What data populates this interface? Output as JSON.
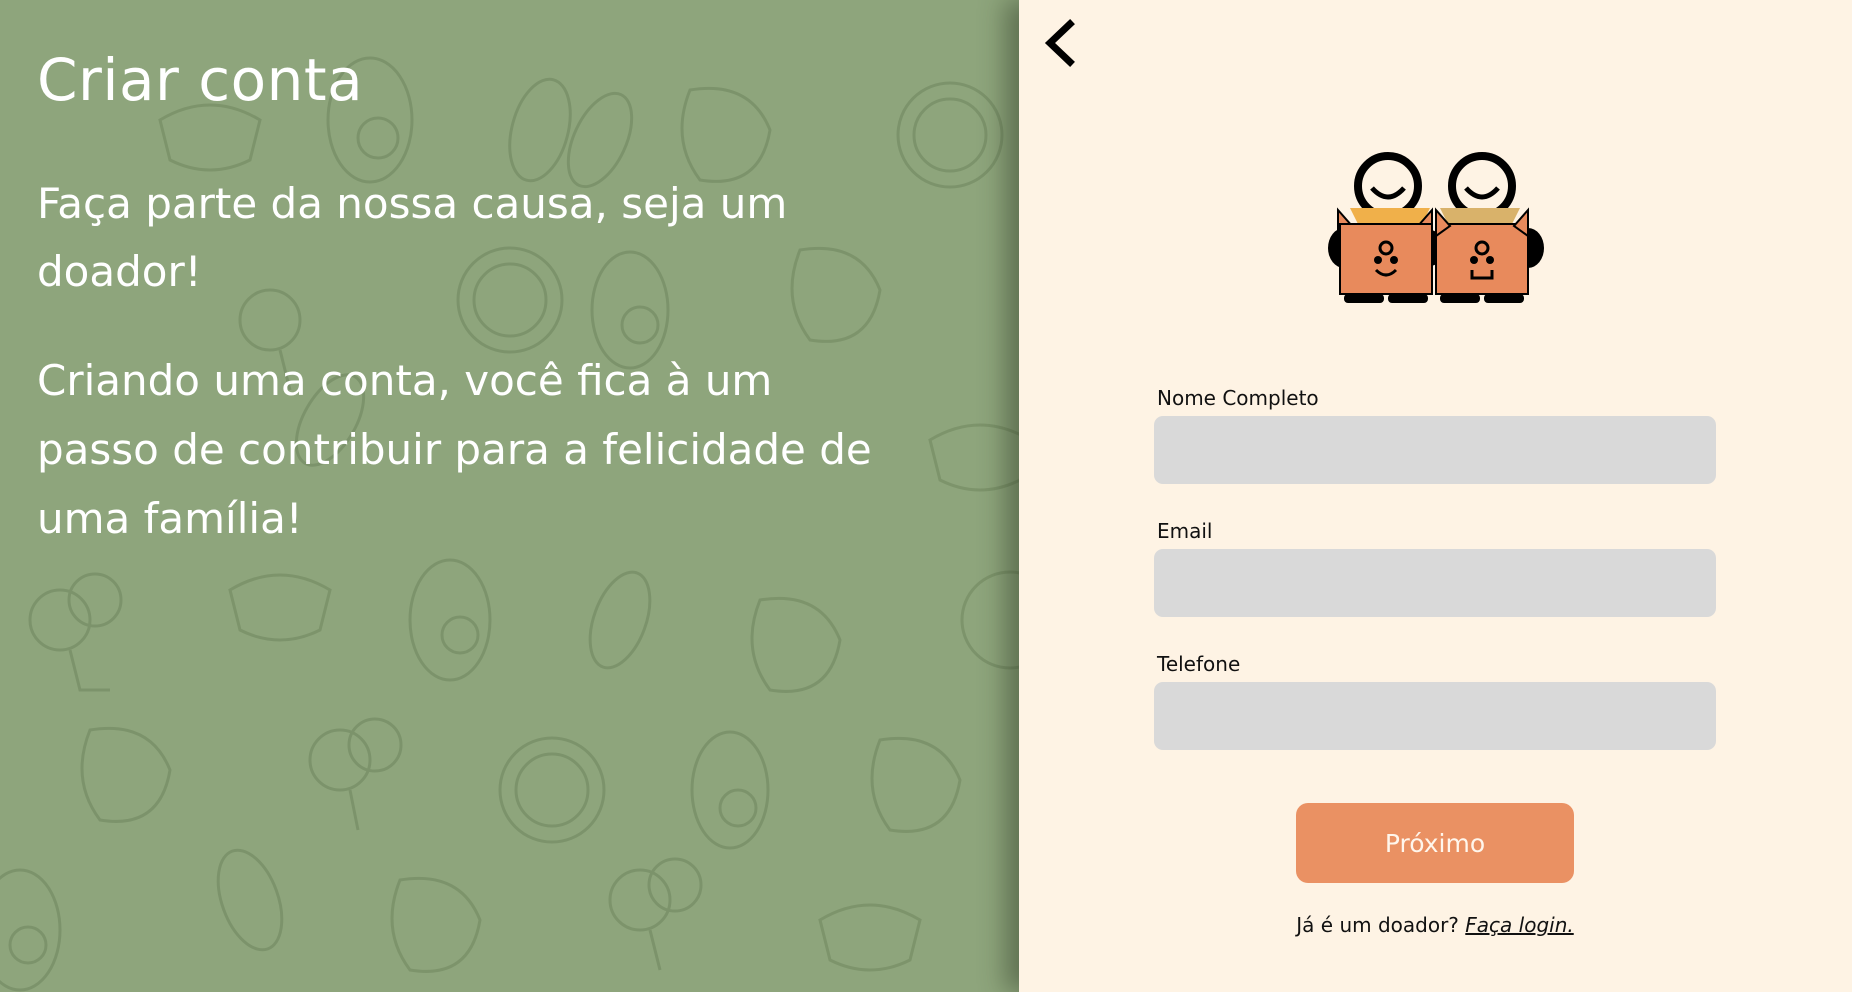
{
  "left": {
    "title": "Criar conta",
    "intro": "Faça parte da nossa causa, seja um doador!",
    "description": "Criando uma conta, você fica à um passo de contribuir para a felicidade de uma família!"
  },
  "header": {
    "back_icon": "chevron-left-icon"
  },
  "logo": {
    "icon": "donation-boxes-logo",
    "box_color": "#e88a5c"
  },
  "form": {
    "fields": [
      {
        "label": "Nome Completo",
        "value": "",
        "placeholder": ""
      },
      {
        "label": "Email",
        "value": "",
        "placeholder": ""
      },
      {
        "label": "Telefone",
        "value": "",
        "placeholder": ""
      }
    ],
    "next_label": "Próximo"
  },
  "footer": {
    "question": "Já é um doador?",
    "login_link": "Faça login."
  },
  "colors": {
    "left_bg": "#8ea57c",
    "right_bg": "#fef3e4",
    "input_bg": "#d9d9d9",
    "accent": "#ea9163"
  }
}
